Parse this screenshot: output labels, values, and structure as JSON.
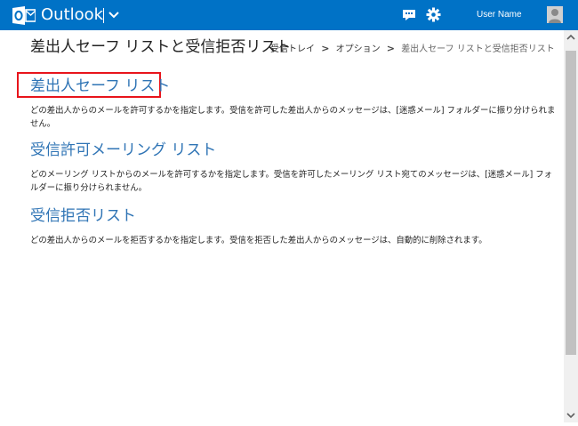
{
  "header": {
    "app_title": "Outlook",
    "user_name": "User Name",
    "icons": [
      "outlook-logo-icon",
      "chevron-down-icon",
      "chat-icon",
      "gear-icon",
      "avatar"
    ],
    "bar_color": "#0072c6"
  },
  "page": {
    "title": "差出人セーフ リストと受信拒否リスト",
    "breadcrumb": {
      "item1": "受信トレイ",
      "item2": "オプション",
      "current": "差出人セーフ リストと受信拒否リスト",
      "separator": ">"
    }
  },
  "sections": [
    {
      "heading": "差出人セーフ リスト",
      "description": "どの差出人からのメールを許可するかを指定します。受信を許可した差出人からのメッセージは、[迷惑メール] フォルダーに振り分けられません。"
    },
    {
      "heading": "受信許可メーリング リスト",
      "description": "どのメーリング リストからのメールを許可するかを指定します。受信を許可したメーリング リスト宛てのメッセージは、[迷惑メール] フォルダーに振り分けられません。"
    },
    {
      "heading": "受信拒否リスト",
      "description": "どの差出人からのメールを拒否するかを指定します。受信を拒否した差出人からのメッセージは、自動的に削除されます。"
    }
  ],
  "colors": {
    "link": "#2f74b5",
    "highlight": "#e8141b"
  }
}
